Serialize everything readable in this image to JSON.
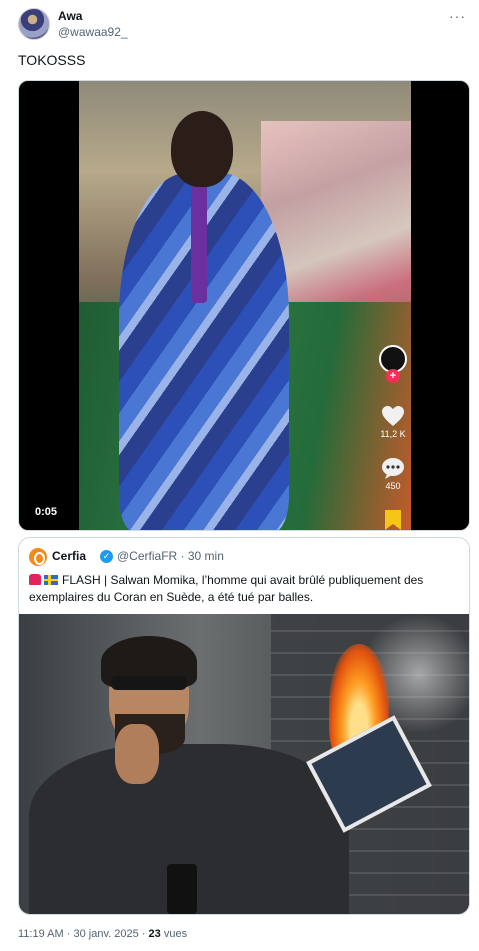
{
  "author": {
    "name": "Awa",
    "handle": "@wawaa92_"
  },
  "more_label": "···",
  "tweet": {
    "text": "TOKOSSS"
  },
  "video": {
    "time": "0:05",
    "likes": "11,2 K",
    "comments": "450",
    "icons": [
      "tiktok-avatar-icon",
      "heart-icon",
      "comment-icon",
      "bookmark-icon"
    ]
  },
  "quote": {
    "name": "Cerfia",
    "handle": "@CerfiaFR",
    "separator": "·",
    "age": "30 min",
    "text": "FLASH | Salwan Momika, l’homme qui avait brûlé publiquement des exemplaires du Coran en Suède, a été tué par balles."
  },
  "meta": {
    "time": "11:19 AM",
    "separator": "·",
    "date": "30 janv. 2025",
    "views_count": "23",
    "views_label": "vues"
  },
  "colors": {
    "verified": "#1d9bf0",
    "secondary_text": "#536471",
    "tiktok_red": "#fe2c55",
    "bookmark": "#f5c518"
  }
}
